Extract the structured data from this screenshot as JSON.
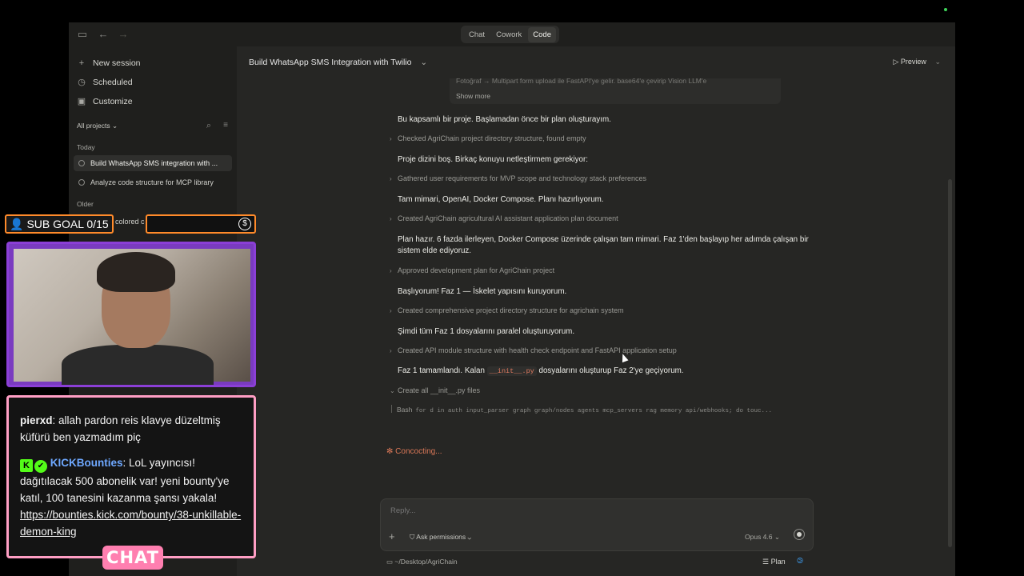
{
  "topbar": {
    "modes": [
      "Chat",
      "Cowork",
      "Code"
    ],
    "active_mode": "Code"
  },
  "sidebar": {
    "new_session": "New session",
    "scheduled": "Scheduled",
    "customize": "Customize",
    "projects_filter": "All projects",
    "today_label": "Today",
    "sessions_today": [
      "Build WhatsApp SMS integration with ...",
      "Analyze code structure for MCP library"
    ],
    "older_label": "Older",
    "older_partial": "colored c"
  },
  "main": {
    "title": "Build WhatsApp SMS Integration with Twilio",
    "preview_label": "Preview",
    "tool_card": {
      "faded_text": "Fotoğraf → Multipart form upload ile FastAPI'ye gelir. base64'e çevirip Vision LLM'e",
      "show_more": "Show more"
    },
    "transcript": [
      {
        "kind": "msg",
        "text": "Bu kapsamlı bir proje. Başlamadan önce bir plan oluşturayım."
      },
      {
        "kind": "step",
        "text": "Checked AgriChain project directory structure, found empty"
      },
      {
        "kind": "msg",
        "text": "Proje dizini boş. Birkaç konuyu netleştirmem gerekiyor:"
      },
      {
        "kind": "step",
        "text": "Gathered user requirements for MVP scope and technology stack preferences"
      },
      {
        "kind": "msg",
        "text": "Tam mimari, OpenAI, Docker Compose. Planı hazırlıyorum."
      },
      {
        "kind": "step",
        "text": "Created AgriChain agricultural AI assistant application plan document"
      },
      {
        "kind": "msg",
        "text": "Plan hazır. 6 fazda ilerleyen, Docker Compose üzerinde çalışan tam mimari. Faz 1'den başlayıp her adımda çalışan bir sistem elde ediyoruz."
      },
      {
        "kind": "step",
        "text": "Approved development plan for AgriChain project"
      },
      {
        "kind": "msg",
        "text": "Başlıyorum! Faz 1 — İskelet yapısını kuruyorum."
      },
      {
        "kind": "step",
        "text": "Created comprehensive project directory structure for agrichain system"
      },
      {
        "kind": "msg",
        "text": "Şimdi tüm Faz 1 dosyalarını paralel oluşturuyorum."
      },
      {
        "kind": "step",
        "text": "Created API module structure with health check endpoint and FastAPI application setup"
      }
    ],
    "last_msg": {
      "before": "Faz 1 tamamlandı. Kalan",
      "code": "__init__.py",
      "after": "dosyalarını oluşturup Faz 2'ye geçiyorum."
    },
    "open_step": "Create all __init__.py files",
    "bash": {
      "label": "Bash",
      "command": "for d in auth input_parser graph graph/nodes agents mcp_servers rag memory api/webhooks; do touc..."
    },
    "status": "✻ Concocting..."
  },
  "composer": {
    "placeholder": "Reply...",
    "permissions": "Ask permissions",
    "model": "Opus 4.6",
    "path": "~/Desktop/AgriChain",
    "plan": "Plan"
  },
  "overlay": {
    "sub_goal": "SUB GOAL 0/15",
    "chat_label": "CHAT",
    "chat_messages": [
      {
        "user": "pierxd",
        "text": "allah pardon reis klavye düzeltmiş küfürü ben yazmadım piç"
      },
      {
        "user": "KICKBounties",
        "text": "LoL yayıncısı! dağıtılacak 500 abonelik var! yeni bounty'ye katıl, 100 tanesini kazanma şansı yakala!",
        "link": "https://bounties.kick.com/bounty/38-unkillable-demon-king"
      }
    ]
  },
  "colors": {
    "accent": "#d97757",
    "background": "#262624",
    "sidebar": "#1f1f1d",
    "stream_purple": "#8b3fd6",
    "stream_pink": "#ff9ec4",
    "kick_green": "#53fc18"
  }
}
